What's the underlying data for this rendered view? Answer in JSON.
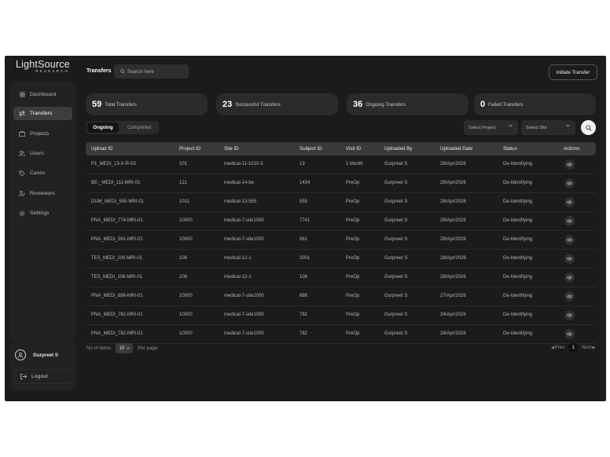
{
  "brand": {
    "name": "LightSource",
    "subtitle": "RESEARCH"
  },
  "sidebar": {
    "items": [
      {
        "label": "Dashboard",
        "icon": "grid-icon",
        "active": false
      },
      {
        "label": "Transfers",
        "icon": "transfer-arrows-icon",
        "active": true
      },
      {
        "label": "Projects",
        "icon": "folder-icon",
        "active": false
      },
      {
        "label": "Users",
        "icon": "users-icon",
        "active": false
      },
      {
        "label": "Cases",
        "icon": "cases-icon",
        "active": false
      },
      {
        "label": "Reviewers",
        "icon": "reviewer-icon",
        "active": false
      },
      {
        "label": "Settings",
        "icon": "gear-icon",
        "active": false
      }
    ],
    "user": {
      "name": "Gurpreet S"
    },
    "logout_label": "Logout"
  },
  "header": {
    "title": "Transfers",
    "search_placeholder": "Search here",
    "initiate_label": "Initiate Transfer"
  },
  "stats": [
    {
      "value": "59",
      "label": "Total Transfers"
    },
    {
      "value": "23",
      "label": "Successful Transfers"
    },
    {
      "value": "36",
      "label": "Ongoing Transfers"
    },
    {
      "value": "0",
      "label": "Failed Transfers"
    }
  ],
  "tabs": {
    "ongoing": "Ongoing",
    "completed": "Completed",
    "active": "Ongoing"
  },
  "filters": {
    "project": "Select Project",
    "site": "Select Site"
  },
  "table": {
    "columns": [
      "Upload ID",
      "Project ID",
      "Site ID",
      "Subject ID",
      "Visit ID",
      "Uploaded By",
      "Uploaded Date",
      "Status",
      "Actions"
    ],
    "rows": [
      [
        "P1_MEDI_13-X-R-03",
        "101",
        "medical-11-1010-3",
        "13",
        "1 Month",
        "Gurpreet S",
        "28/Apr/2026",
        "De-Identifying"
      ],
      [
        "BE-_MEDI_111-MRI-01",
        "121",
        "medical-14-be",
        "1434",
        "PreOp",
        "Gurpreet S",
        "28/Apr/2026",
        "De-Identifying"
      ],
      [
        "DUM_MEDI_555-MRI-01",
        "1011",
        "medical-13-555",
        "555",
        "PreOp",
        "Gurpreet S",
        "28/Apr/2026",
        "De-Identifying"
      ],
      [
        "PNA_MEDI_774-MRI-01",
        "10000",
        "medical-7-site1000",
        "7741",
        "PreOp",
        "Gurpreet S",
        "28/Apr/2026",
        "De-Identifying"
      ],
      [
        "PNA_MEDI_561-MRI-01",
        "10000",
        "medical-7-site1000",
        "561",
        "PreOp",
        "Gurpreet S",
        "28/Apr/2026",
        "De-Identifying"
      ],
      [
        "TES_MEDI_200-MRI-01",
        "106",
        "medical-12-1",
        "2001",
        "PreOp",
        "Gurpreet S",
        "28/Apr/2026",
        "De-Identifying"
      ],
      [
        "TES_MEDI_106-MRI-01",
        "106",
        "medical-12-1",
        "106",
        "PreOp",
        "Gurpreet S",
        "28/Apr/2026",
        "De-Identifying"
      ],
      [
        "PNA_MEDI_886-MRI-01",
        "10000",
        "medical-7-site1000",
        "886",
        "PreOp",
        "Gurpreet S",
        "27/Apr/2026",
        "De-Identifying"
      ],
      [
        "PNA_MEDI_782-MRI-01",
        "10000",
        "medical-7-site1000",
        "782",
        "PreOp",
        "Gurpreet S",
        "24/Apr/2026",
        "De-Identifying"
      ],
      [
        "PNA_MEDI_782-MRI-01",
        "10000",
        "medical-7-site1000",
        "782",
        "PreOp",
        "Gurpreet S",
        "24/Apr/2026",
        "De-Identifying"
      ]
    ]
  },
  "pagination": {
    "no_of_items_label": "No of items",
    "per_page_value": "10",
    "per_page_label": "Per page",
    "prev_label": "Prev",
    "next_label": "Next",
    "current_page": "1"
  },
  "colors": {
    "app_bg": "#1b1b1c",
    "panel": "#2b2b2d",
    "active_nav": "#3d3d40",
    "text": "#ffffff"
  }
}
